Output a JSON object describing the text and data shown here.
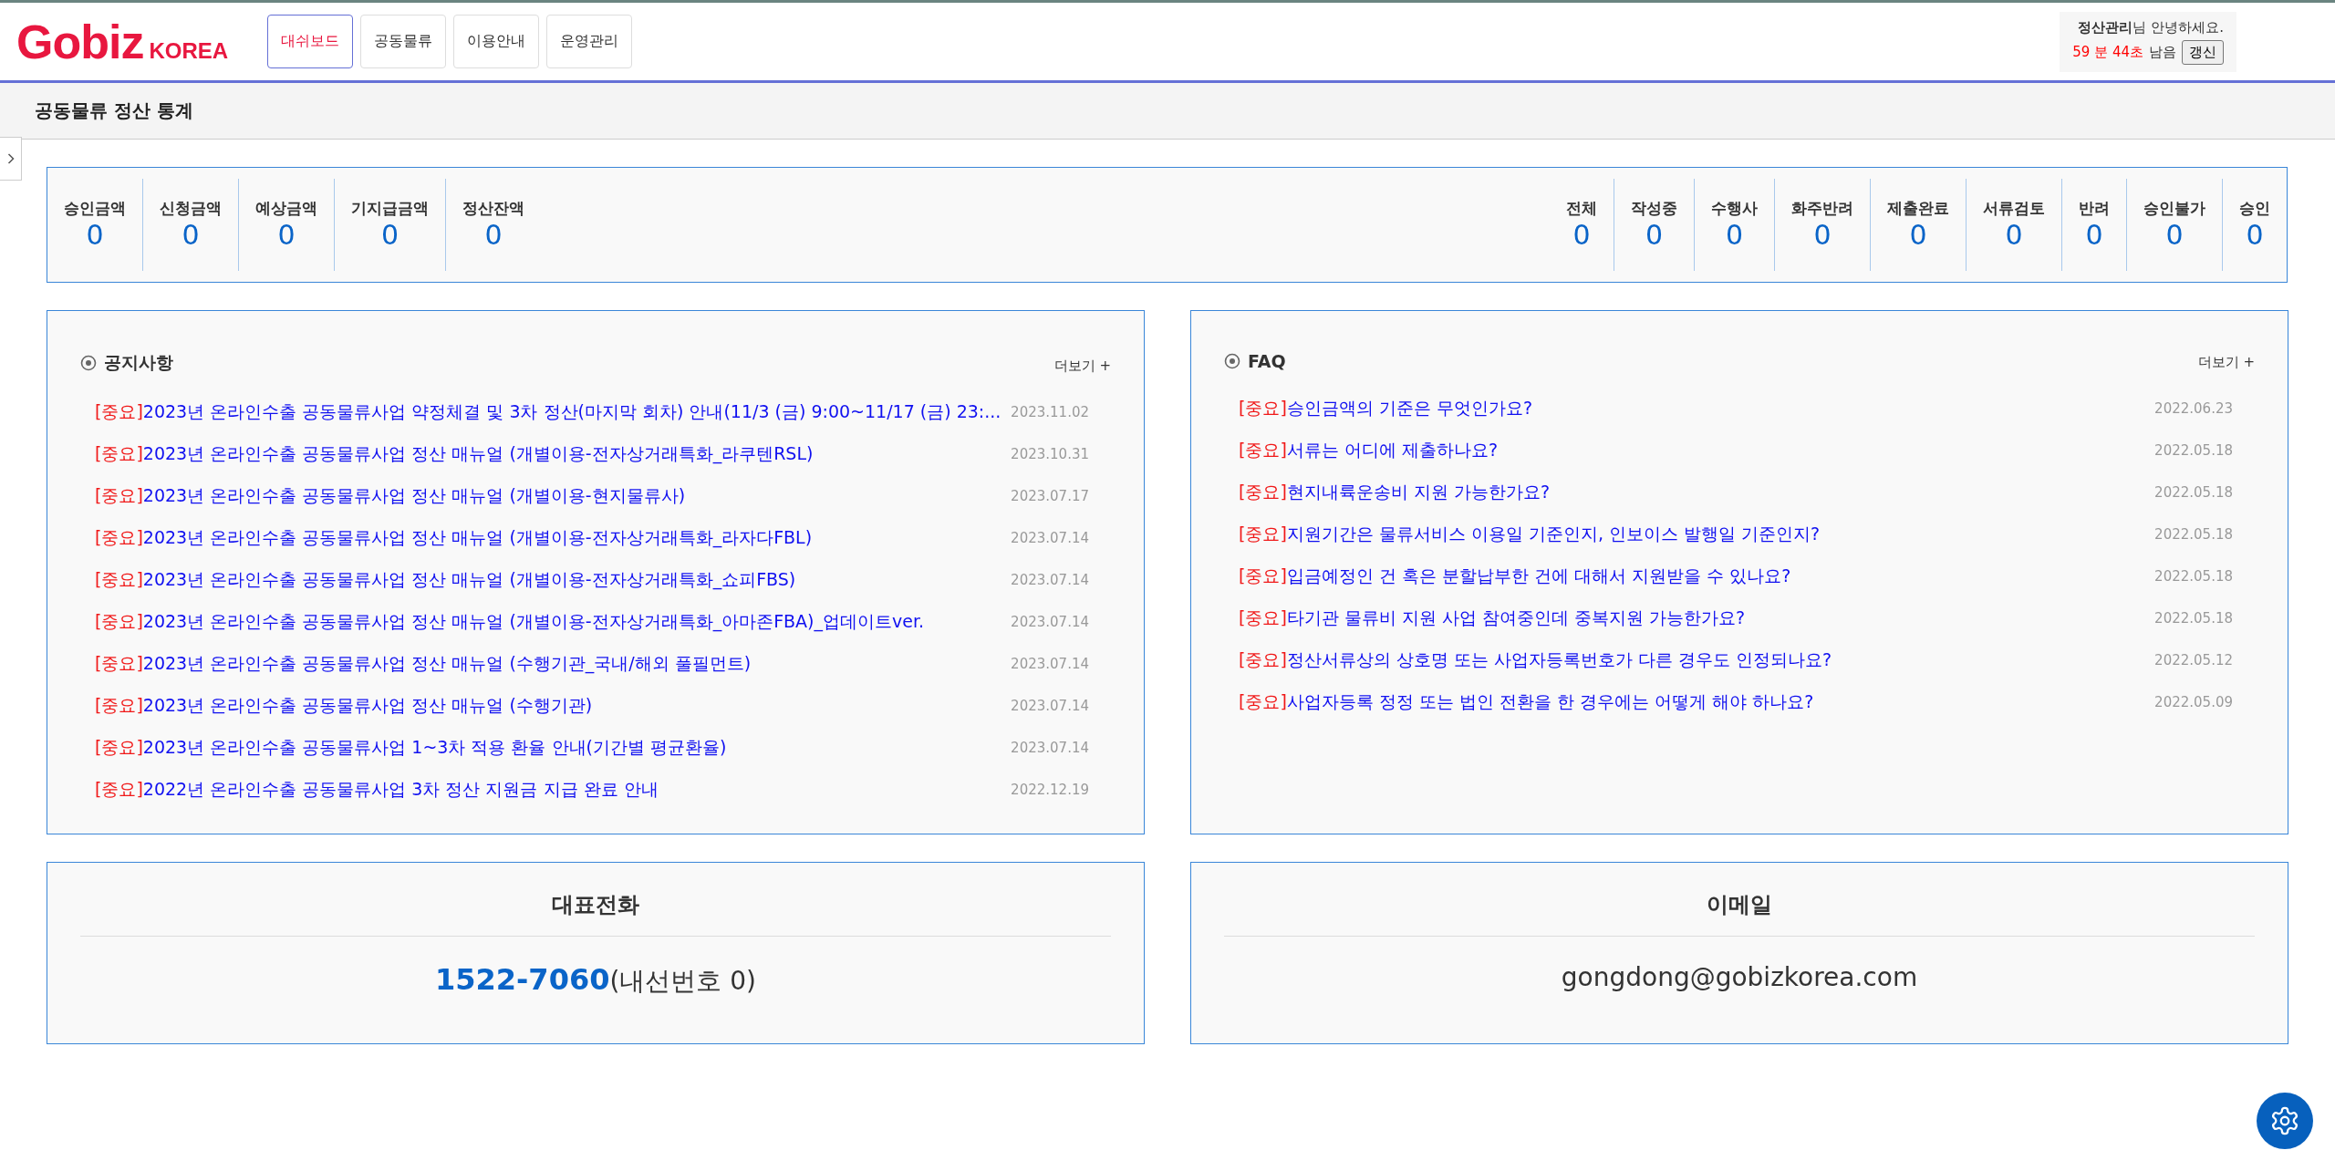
{
  "logo": {
    "main": "Gobiz",
    "sub": "KOREA"
  },
  "nav": [
    {
      "label": "대쉬보드",
      "selected": true
    },
    {
      "label": "공동물류",
      "selected": false
    },
    {
      "label": "이용안내",
      "selected": false
    },
    {
      "label": "운영관리",
      "selected": false
    }
  ],
  "user": {
    "greeting": "**정산관리**님 안녕하세요.",
    "timer": "59 분 44초",
    "remaining": "남음",
    "refresh": "갱신"
  },
  "page_title": "공동물류 정산 통계",
  "amounts": [
    {
      "label": "승인금액",
      "value": "0"
    },
    {
      "label": "신청금액",
      "value": "0"
    },
    {
      "label": "예상금액",
      "value": "0"
    },
    {
      "label": "기지급금액",
      "value": "0"
    },
    {
      "label": "정산잔액",
      "value": "0"
    }
  ],
  "statuses": [
    {
      "label": "전체",
      "value": "0"
    },
    {
      "label": "작성중",
      "value": "0"
    },
    {
      "label": "수행사",
      "value": "0"
    },
    {
      "label": "화주반려",
      "value": "0"
    },
    {
      "label": "제출완료",
      "value": "0"
    },
    {
      "label": "서류검토",
      "value": "0"
    },
    {
      "label": "반려",
      "value": "0"
    },
    {
      "label": "승인불가",
      "value": "0"
    },
    {
      "label": "승인",
      "value": "0"
    }
  ],
  "boards": [
    {
      "title": "공지사항",
      "more": "더보기 +",
      "items": [
        {
          "tag": "[중요]",
          "title": "2023년 온라인수출 공동물류사업 약정체결 및 3차 정산(마지막 회차) 안내(11/3 (금) 9:00~11/17 (금) 23:...",
          "date": "2023.11.02"
        },
        {
          "tag": "[중요]",
          "title": "2023년 온라인수출 공동물류사업 정산 매뉴얼 (개별이용-전자상거래특화_라쿠텐RSL)",
          "date": "2023.10.31"
        },
        {
          "tag": "[중요]",
          "title": "2023년 온라인수출 공동물류사업 정산 매뉴얼 (개별이용-현지물류사)",
          "date": "2023.07.17"
        },
        {
          "tag": "[중요]",
          "title": "2023년 온라인수출 공동물류사업 정산 매뉴얼 (개별이용-전자상거래특화_라자다FBL)",
          "date": "2023.07.14"
        },
        {
          "tag": "[중요]",
          "title": "2023년 온라인수출 공동물류사업 정산 매뉴얼 (개별이용-전자상거래특화_쇼피FBS)",
          "date": "2023.07.14"
        },
        {
          "tag": "[중요]",
          "title": "2023년 온라인수출 공동물류사업 정산 매뉴얼 (개별이용-전자상거래특화_아마존FBA)_업데이트ver.",
          "date": "2023.07.14"
        },
        {
          "tag": "[중요]",
          "title": "2023년 온라인수출 공동물류사업 정산 매뉴얼 (수행기관_국내/해외 풀필먼트)",
          "date": "2023.07.14"
        },
        {
          "tag": "[중요]",
          "title": "2023년 온라인수출 공동물류사업 정산 매뉴얼 (수행기관)",
          "date": "2023.07.14"
        },
        {
          "tag": "[중요]",
          "title": "2023년 온라인수출 공동물류사업 1~3차 적용 환율 안내(기간별 평균환율)",
          "date": "2023.07.14"
        },
        {
          "tag": "[중요]",
          "title": "2022년 온라인수출 공동물류사업 3차 정산 지원금 지급 완료 안내",
          "date": "2022.12.19"
        }
      ]
    },
    {
      "title": "FAQ",
      "more": "더보기 +",
      "items": [
        {
          "tag": "[중요]",
          "title": "승인금액의 기준은 무엇인가요?",
          "date": "2022.06.23"
        },
        {
          "tag": "[중요]",
          "title": "서류는 어디에 제출하나요?",
          "date": "2022.05.18"
        },
        {
          "tag": "[중요]",
          "title": "현지내륙운송비 지원 가능한가요?",
          "date": "2022.05.18"
        },
        {
          "tag": "[중요]",
          "title": "지원기간은 물류서비스 이용일 기준인지, 인보이스 발행일 기준인지?",
          "date": "2022.05.18"
        },
        {
          "tag": "[중요]",
          "title": "입금예정인 건 혹은 분할납부한 건에 대해서 지원받을 수 있나요?",
          "date": "2022.05.18"
        },
        {
          "tag": "[중요]",
          "title": "타기관 물류비 지원 사업 참여중인데 중복지원 가능한가요?",
          "date": "2022.05.18"
        },
        {
          "tag": "[중요]",
          "title": "정산서류상의 상호명 또는 사업자등록번호가 다른 경우도 인정되나요?",
          "date": "2022.05.12"
        },
        {
          "tag": "[중요]",
          "title": "사업자등록 정정 또는 법인 전환을 한 경우에는 어떻게 해야 하나요?",
          "date": "2022.05.09"
        }
      ]
    }
  ],
  "contacts": [
    {
      "kind": "phone",
      "title": "대표전화",
      "number": "1522-7060",
      "extension": "(내선번호 0)"
    },
    {
      "kind": "email",
      "title": "이메일",
      "email": "gongdong@gobizkorea.com"
    }
  ]
}
